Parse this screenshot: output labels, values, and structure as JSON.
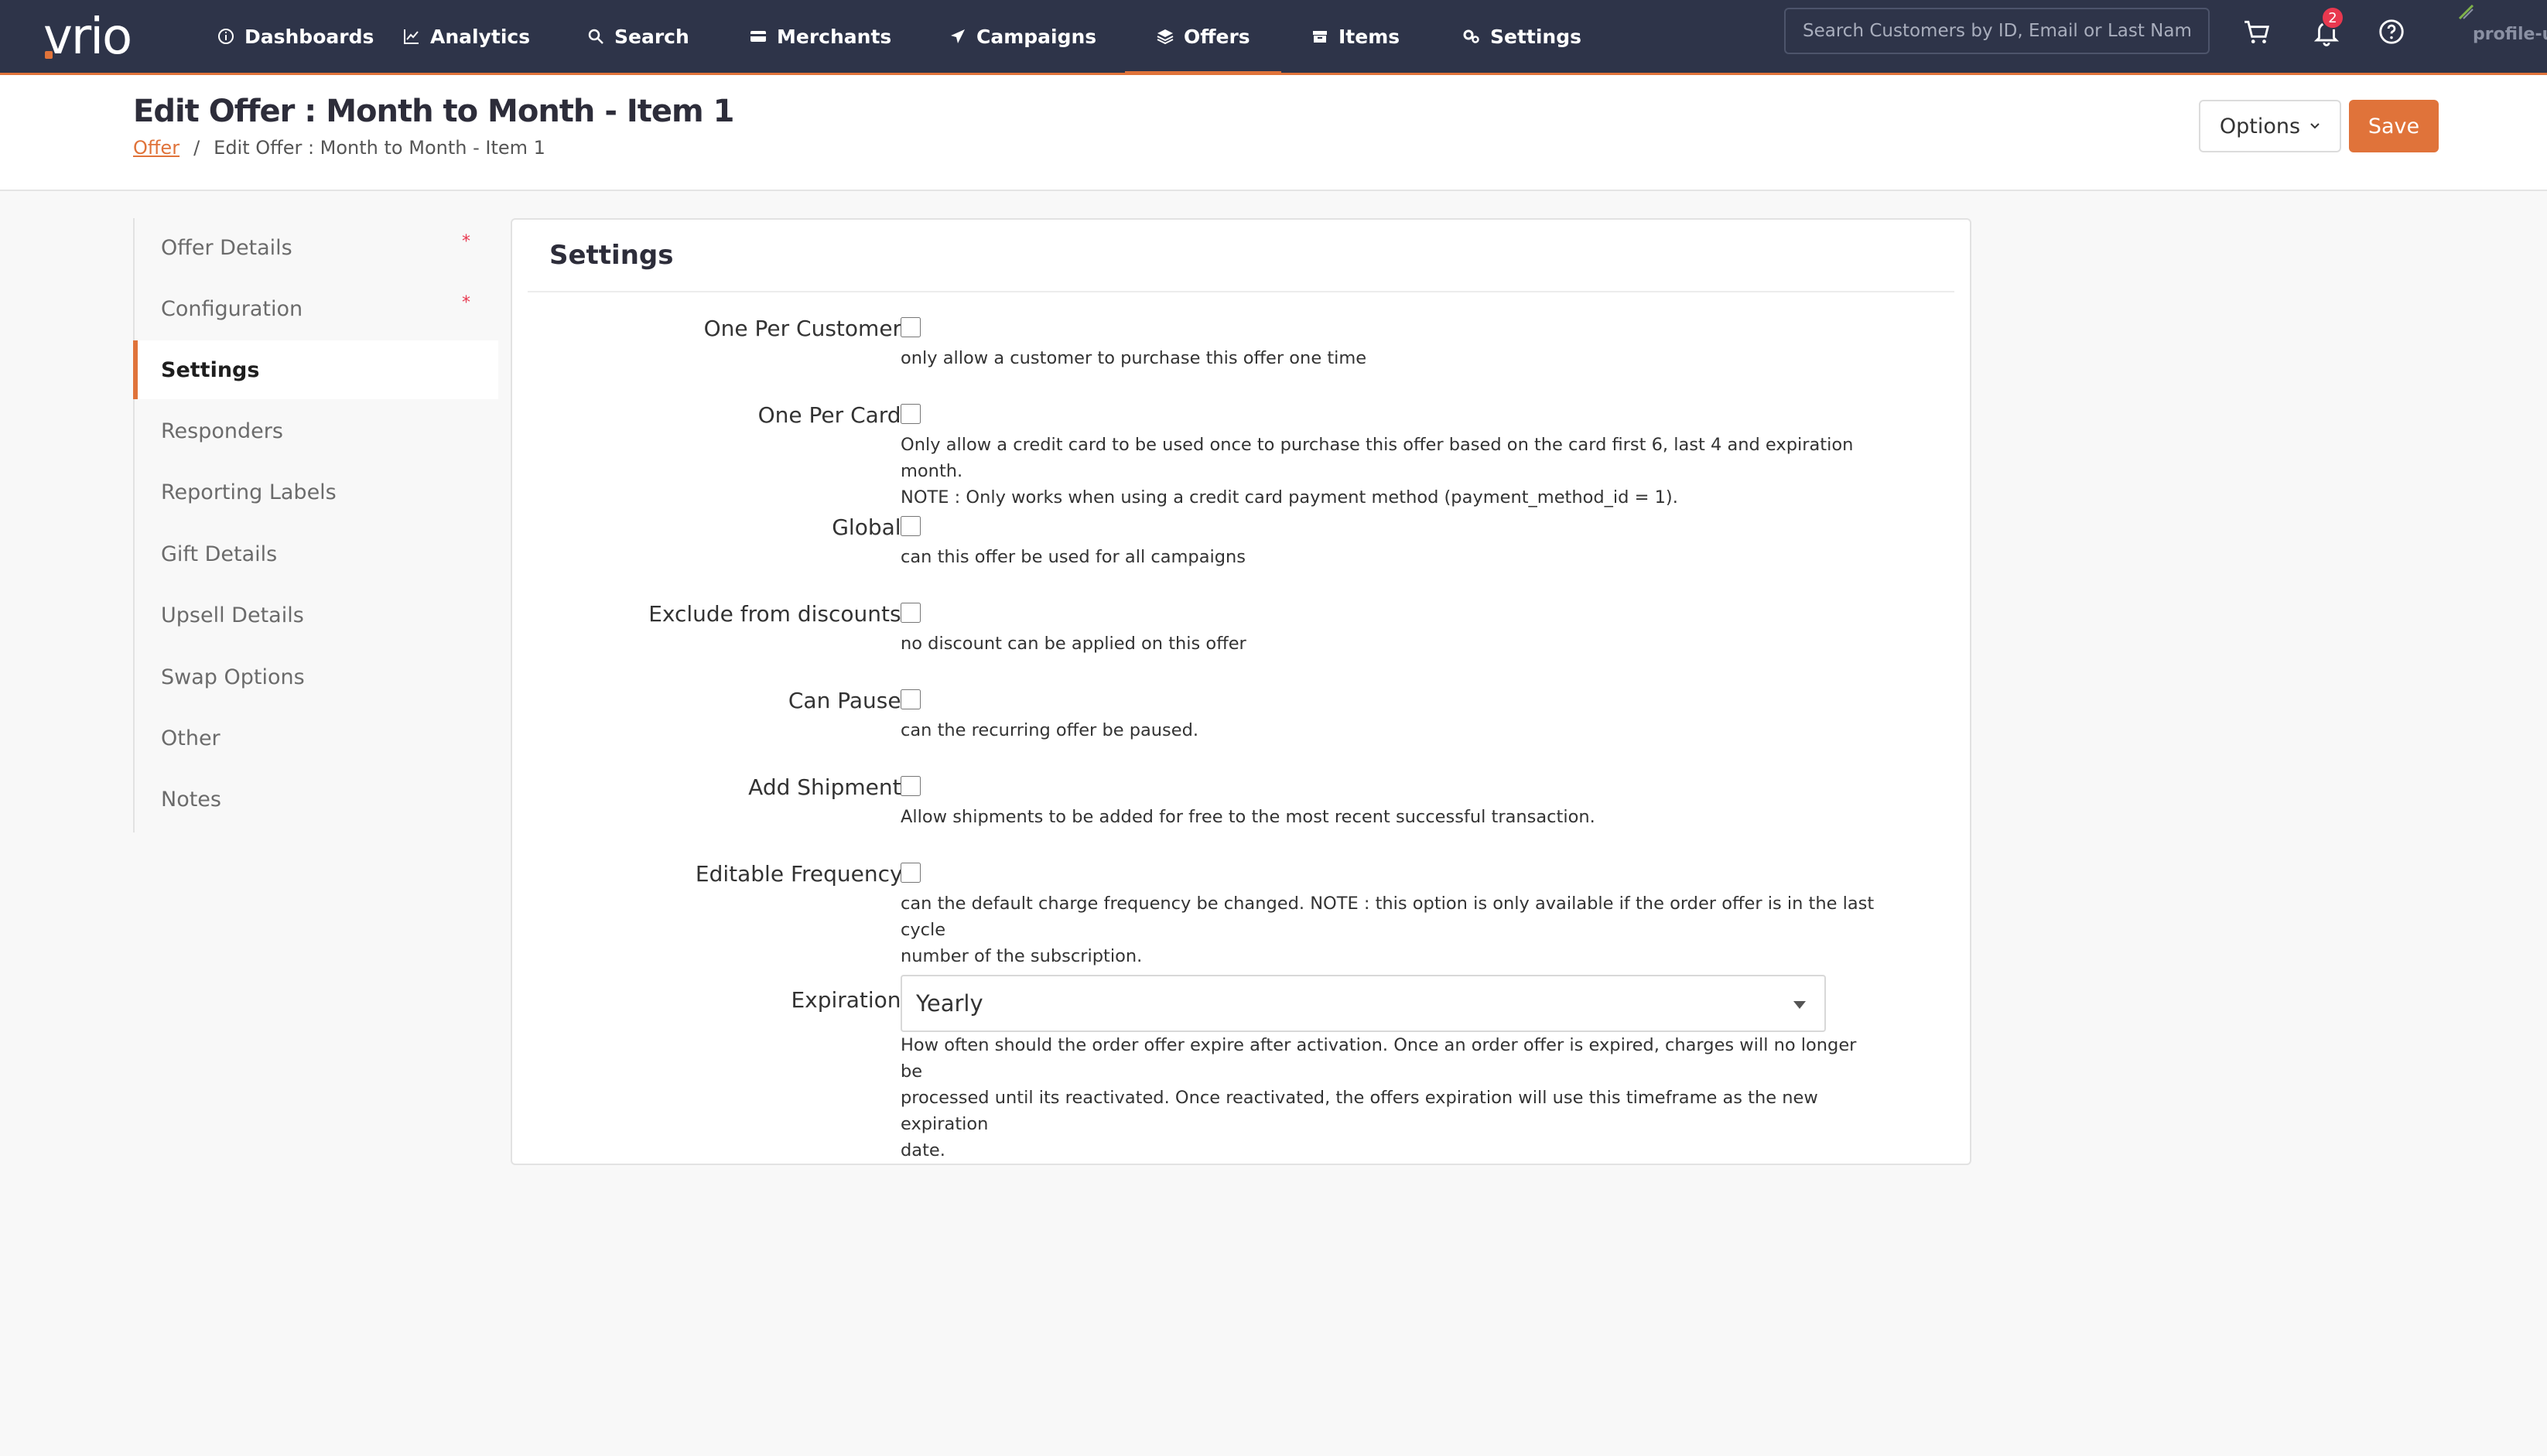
{
  "brand": {
    "logo": "vrio"
  },
  "nav": {
    "items": [
      {
        "label": "Dashboards",
        "icon": "info-circle-icon"
      },
      {
        "label": "Analytics",
        "icon": "chart-line-icon"
      },
      {
        "label": "Search",
        "icon": "search-icon"
      },
      {
        "label": "Merchants",
        "icon": "credit-card-icon"
      },
      {
        "label": "Campaigns",
        "icon": "paper-plane-icon"
      },
      {
        "label": "Offers",
        "icon": "layers-icon"
      },
      {
        "label": "Items",
        "icon": "box-icon"
      },
      {
        "label": "Settings",
        "icon": "gears-icon"
      }
    ],
    "active": "Offers",
    "search_placeholder": "Search Customers by ID, Email or Last Name",
    "notification_count": "2",
    "profile_label": "profile-u"
  },
  "header": {
    "title": "Edit Offer : Month to Month - Item 1",
    "breadcrumb_link": "Offer",
    "breadcrumb_sep": "/",
    "breadcrumb_current": "Edit Offer : Month to Month - Item 1",
    "options_label": "Options",
    "save_label": "Save"
  },
  "sidebar": {
    "items": [
      {
        "label": "Offer Details",
        "required": true
      },
      {
        "label": "Configuration",
        "required": true
      },
      {
        "label": "Settings",
        "required": false
      },
      {
        "label": "Responders",
        "required": false
      },
      {
        "label": "Reporting Labels",
        "required": false
      },
      {
        "label": "Gift Details",
        "required": false
      },
      {
        "label": "Upsell Details",
        "required": false
      },
      {
        "label": "Swap Options",
        "required": false
      },
      {
        "label": "Other",
        "required": false
      },
      {
        "label": "Notes",
        "required": false
      }
    ],
    "active": "Settings",
    "required_mark": "*"
  },
  "settings": {
    "title": "Settings",
    "rows": [
      {
        "label": "One Per Customer:",
        "checked": false,
        "help": [
          "only allow a customer to purchase this offer one time"
        ]
      },
      {
        "label": "One Per Card:",
        "checked": false,
        "help": [
          "Only allow a credit card to be used once to purchase this offer based on the card first 6, last 4 and expiration month.",
          "NOTE : Only works when using a credit card payment method (payment_method_id = 1)."
        ]
      },
      {
        "label": "Global:",
        "checked": false,
        "help": [
          "can this offer be used for all campaigns"
        ]
      },
      {
        "label": "Exclude from discounts:",
        "checked": false,
        "help": [
          "no discount can be applied on this offer"
        ]
      },
      {
        "label": "Can Pause:",
        "checked": false,
        "help": [
          "can the recurring offer be paused."
        ]
      },
      {
        "label": "Add Shipment:",
        "checked": false,
        "help": [
          "Allow shipments to be added for free to the most recent successful transaction."
        ]
      },
      {
        "label": "Editable Frequency:",
        "checked": false,
        "help": [
          "can the default charge frequency be changed. NOTE : this option is only available if the order offer is in the last cycle",
          "number of the subscription."
        ]
      }
    ],
    "expiration": {
      "label": "Expiration:",
      "value": "Yearly",
      "help": [
        "How often should the order offer expire after activation. Once an order offer is expired, charges will no longer be",
        "processed until its reactivated. Once reactivated, the offers expiration will use this timeframe as the new expiration",
        "date."
      ]
    }
  },
  "colors": {
    "nav_bg": "#2e3449",
    "accent": "#e0733a",
    "required": "#e8384f"
  }
}
